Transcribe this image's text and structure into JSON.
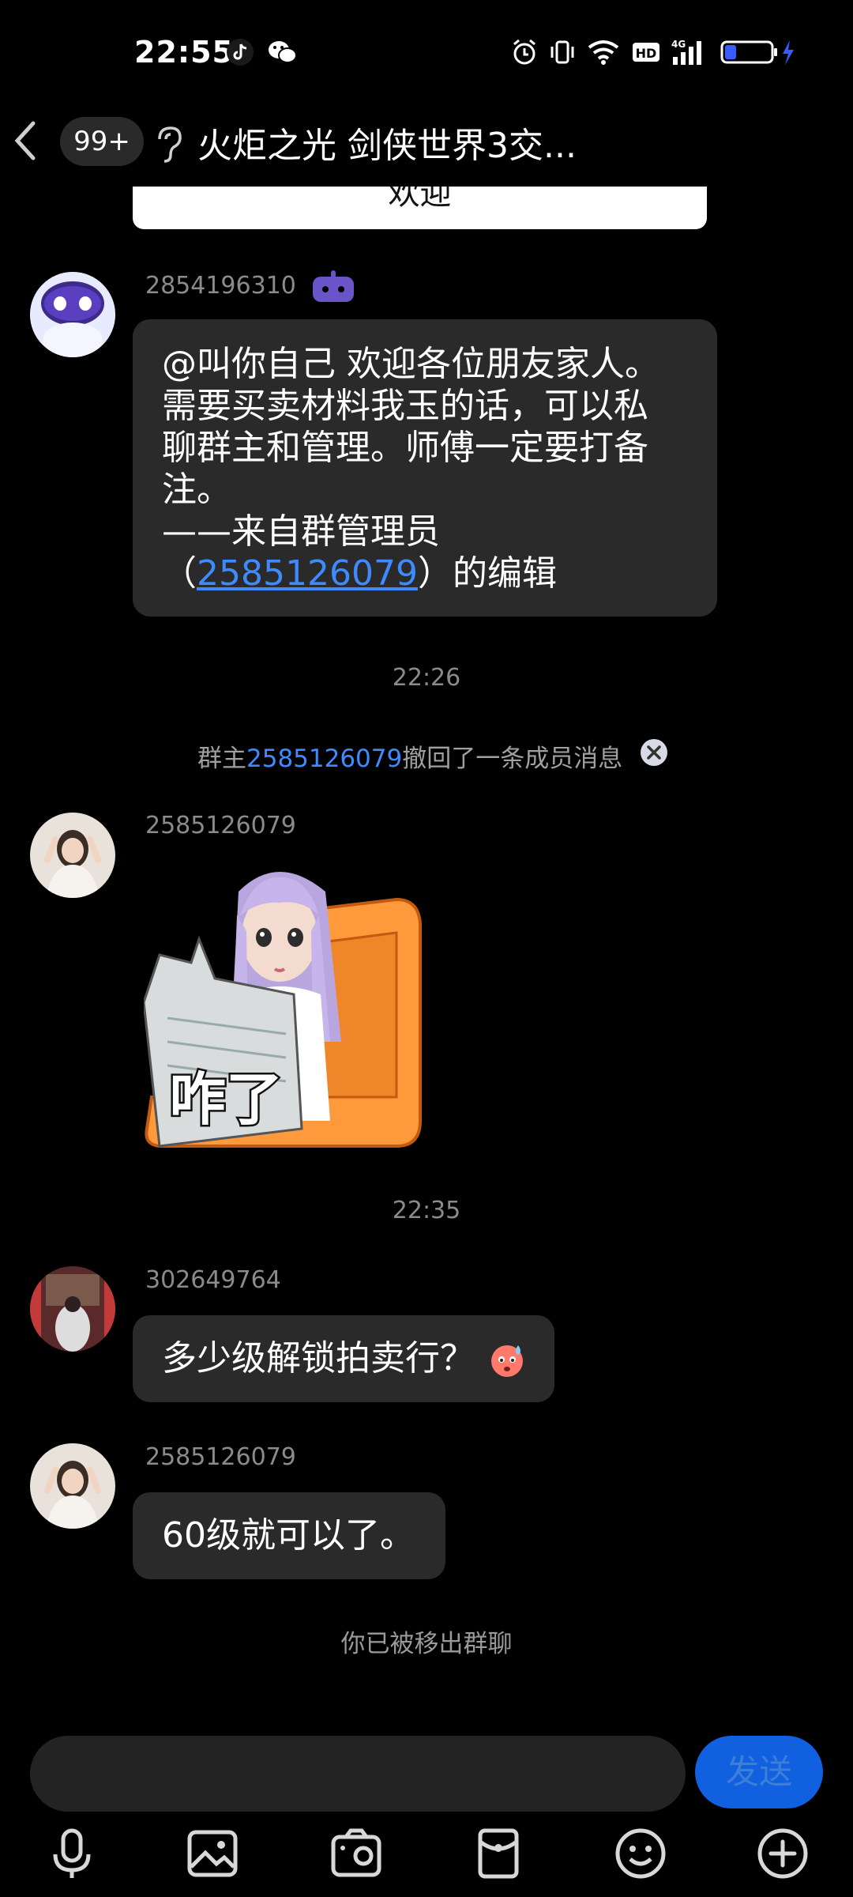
{
  "status_bar": {
    "time": "22:55",
    "battery_level": 0.25
  },
  "header": {
    "back_label": "<",
    "unread_badge": "99+",
    "title": "火炬之光 剑侠世界3交..."
  },
  "prev_message_tail": "欢迎",
  "messages": [
    {
      "sender": "2854196310",
      "lines": [
        "@叫你自己 欢迎各位朋友家人。",
        "需要买卖材料我玉的话，可以私",
        "聊群主和管理。师傅一定要打备",
        "注。",
        "——来自群管理员"
      ],
      "last_line": {
        "open": "（",
        "link": "2585126079",
        "close": "）的编辑"
      }
    },
    {
      "time": "22:26"
    },
    {
      "system": {
        "prefix": "群主",
        "link": "2585126079",
        "suffix": "撤回了一条成员消息"
      }
    },
    {
      "sender": "2585126079",
      "sticker_text": "咋了"
    },
    {
      "time": "22:35"
    },
    {
      "sender": "302649764",
      "text": "多少级解锁拍卖行？"
    },
    {
      "sender": "2585126079",
      "text": "60级就可以了。"
    },
    {
      "notice": "你已被移出群聊"
    }
  ],
  "input": {
    "placeholder": "",
    "send_label": "发送"
  },
  "toolbar": [
    "mic-icon",
    "image-icon",
    "camera-icon",
    "red-packet-icon",
    "emoji-icon",
    "plus-icon"
  ],
  "colors": {
    "bubble": "#2a2a2a",
    "link": "#3e8bff",
    "send": "#1060e0",
    "bot_icon": "#6a55c8"
  }
}
